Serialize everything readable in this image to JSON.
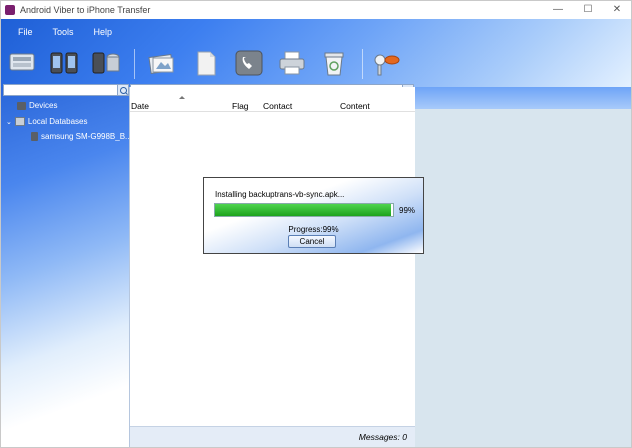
{
  "window": {
    "title": "Android Viber to iPhone Transfer",
    "min_glyph": "—",
    "max_glyph": "☐",
    "close_glyph": "✕"
  },
  "menu": [
    "File",
    "Tools",
    "Help"
  ],
  "toolbar_icons": [
    "backup-icon",
    "transfer-phone-icon",
    "database-icon",
    "export-icon",
    "document-icon",
    "call-icon",
    "print-icon",
    "trash-icon",
    "key-icon"
  ],
  "tree": {
    "devices": "Devices",
    "local_databases": "Local Databases",
    "device_entry": "samsung SM-G998B_B..."
  },
  "columns": {
    "date": "Date",
    "flag": "Flag",
    "contact": "Contact",
    "content": "Content"
  },
  "status": {
    "messages": "Messages: 0"
  },
  "dialog": {
    "message": "Installing backuptrans-vb-sync.apk...",
    "percent_text": "99%",
    "progress_label": "Progress:99%",
    "progress_value": 0.99,
    "cancel": "Cancel"
  },
  "colors": {
    "accent": "#3d7ff0",
    "progress": "#1da31d"
  }
}
